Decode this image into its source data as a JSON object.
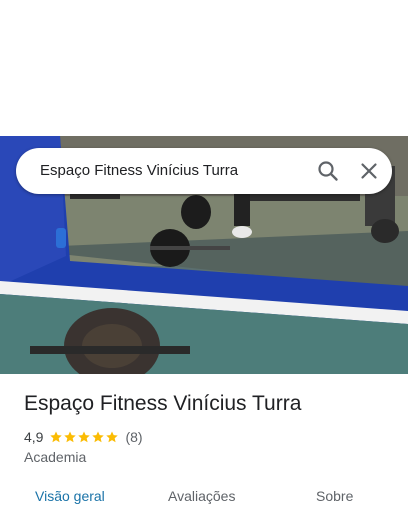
{
  "search": {
    "query": "Espaço Fitness Vinícius Turra"
  },
  "place": {
    "name": "Espaço Fitness Vinícius Turra",
    "rating": "4,9",
    "stars": 5,
    "review_count": "(8)",
    "category": "Academia"
  },
  "tabs": [
    {
      "label": "Visão geral",
      "active": true
    },
    {
      "label": "Avaliações",
      "active": false
    },
    {
      "label": "Sobre",
      "active": false
    }
  ],
  "colors": {
    "accent": "#1a73a8",
    "star": "#fbbc04"
  }
}
